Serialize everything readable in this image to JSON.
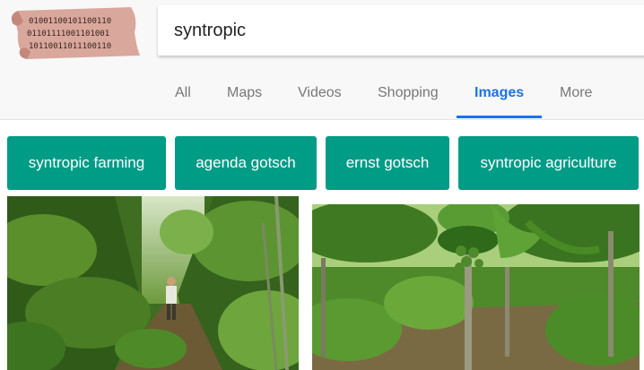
{
  "search": {
    "query": "syntropic"
  },
  "tabs": [
    {
      "label": "All"
    },
    {
      "label": "Maps"
    },
    {
      "label": "Videos"
    },
    {
      "label": "Shopping"
    },
    {
      "label": "Images"
    },
    {
      "label": "More"
    }
  ],
  "active_tab": "Images",
  "suggestions": [
    {
      "label": "syntropic farming"
    },
    {
      "label": "agenda gotsch"
    },
    {
      "label": "ernst gotsch"
    },
    {
      "label": "syntropic agriculture"
    }
  ],
  "colors": {
    "accent": "#1a73e8",
    "chip": "#009c86",
    "logo_parchment": "#d9a79b"
  },
  "logo": {
    "text_rows": [
      "01001100101100110",
      "01101111001101001",
      "10110011011100110"
    ]
  },
  "images": [
    {
      "subject": "man-walking-in-forest"
    },
    {
      "subject": "papaya-banana-plantation"
    }
  ]
}
